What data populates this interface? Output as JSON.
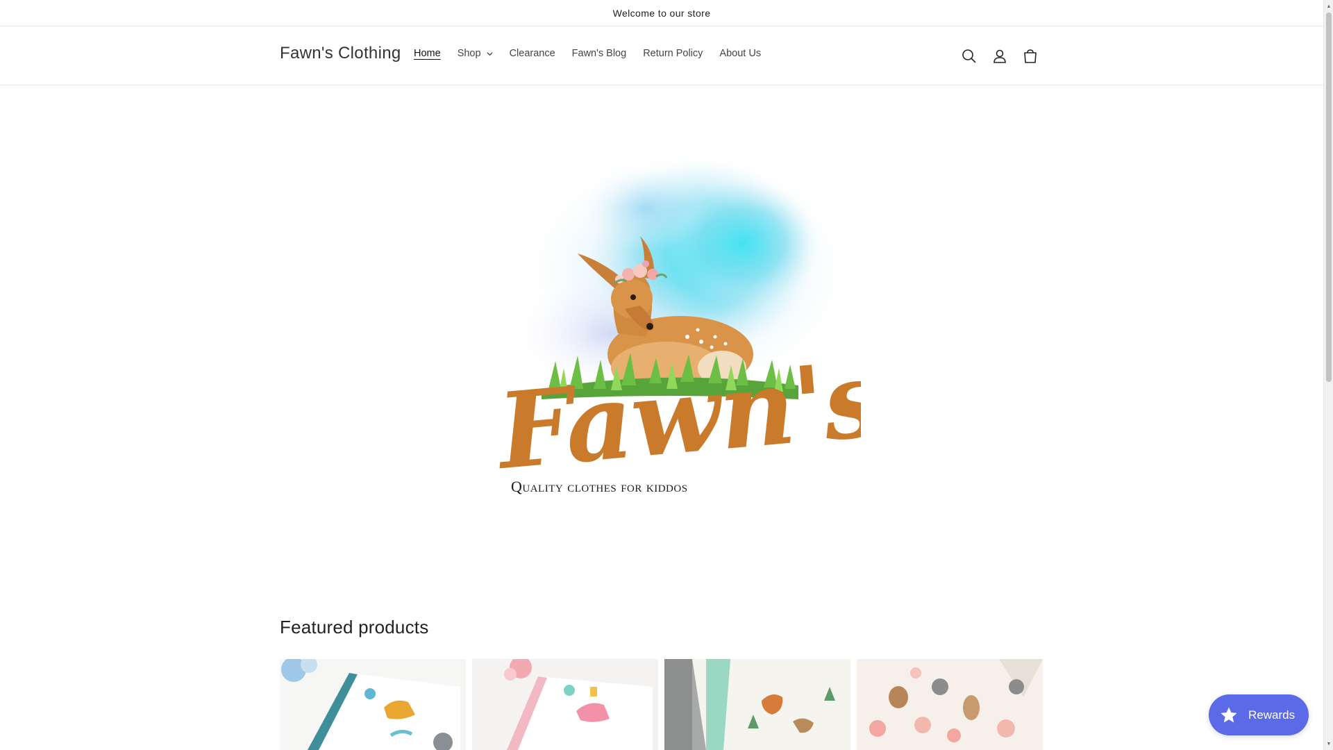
{
  "announcement": {
    "text": "Welcome to our store"
  },
  "header": {
    "store_name": "Fawn's Clothing",
    "nav": [
      {
        "label": "Home",
        "active": true
      },
      {
        "label": "Shop",
        "has_dropdown": true
      },
      {
        "label": "Clearance"
      },
      {
        "label": "Fawn's Blog"
      },
      {
        "label": "Return Policy"
      },
      {
        "label": "About Us"
      }
    ],
    "icons": [
      "search-icon",
      "account-icon",
      "cart-icon"
    ]
  },
  "hero": {
    "logo_wordmark": "Fawn's",
    "logo_tagline": "Quality clothes for kiddos"
  },
  "featured": {
    "title": "Featured products"
  },
  "rewards": {
    "label": "Rewards"
  },
  "colors": {
    "rewards_bg": "#5b6ae6",
    "logo_orange": "#c97a2b",
    "watercolor_blue": "#6fe0ee"
  }
}
